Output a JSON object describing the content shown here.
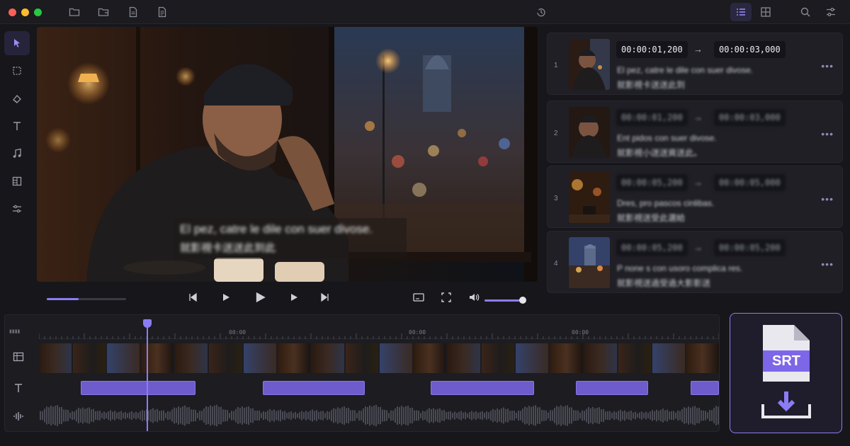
{
  "window": {
    "controls": [
      "close",
      "minimize",
      "maximize"
    ]
  },
  "toolbar": {
    "icons": [
      "folder-icon",
      "folder-open-icon",
      "document-icon",
      "document-text-icon",
      "history-icon"
    ],
    "right_icons": [
      "list-view-icon",
      "grid-view-icon",
      "search-icon",
      "adjust-icon"
    ]
  },
  "left_tools": [
    "select-tool-icon",
    "crop-tool-icon",
    "fill-tool-icon",
    "text-tool-icon",
    "music-tool-icon",
    "split-tool-icon",
    "adjust-tool-icon"
  ],
  "preview": {
    "subtitle_line1": "El pez, catre le dile con suer divose.",
    "subtitle_line2": "就影視卡送送此到此"
  },
  "transport": {
    "progress_fraction": 0.4,
    "volume_fraction": 0.72
  },
  "subtitles": [
    {
      "index": "1",
      "start": "00:00:01,200",
      "end": "00:00:03,000",
      "line1": "El pez, catre le dile con suer divose.",
      "line2": "就影視卡送送此到",
      "active": true
    },
    {
      "index": "2",
      "start": "00:00:01,200",
      "end": "00:00:03,000",
      "line1": "Ent pidos con suer divose.",
      "line2": "就影視小送送資送此。",
      "active": false
    },
    {
      "index": "3",
      "start": "00:00:05,200",
      "end": "00:00:05,000",
      "line1": "Dres, pro pascos cinlibas.",
      "line2": "就影視送受此選給",
      "active": false
    },
    {
      "index": "4",
      "start": "00:00:05,200",
      "end": "00:00:05,200",
      "line1": "P none s con usoro complica res.",
      "line2": "就影視送過受過大影影送",
      "active": false
    }
  ],
  "timeline": {
    "ruler_labels": [
      "00:00",
      "00:00",
      "00:00"
    ],
    "track_icons": [
      "video-track-icon",
      "text-track-icon",
      "audio-track-icon"
    ],
    "clips": 5
  },
  "export": {
    "badge": "SRT"
  },
  "colors": {
    "accent": "#8b7cf6",
    "background": "#17171b",
    "card": "#1f1f25"
  }
}
